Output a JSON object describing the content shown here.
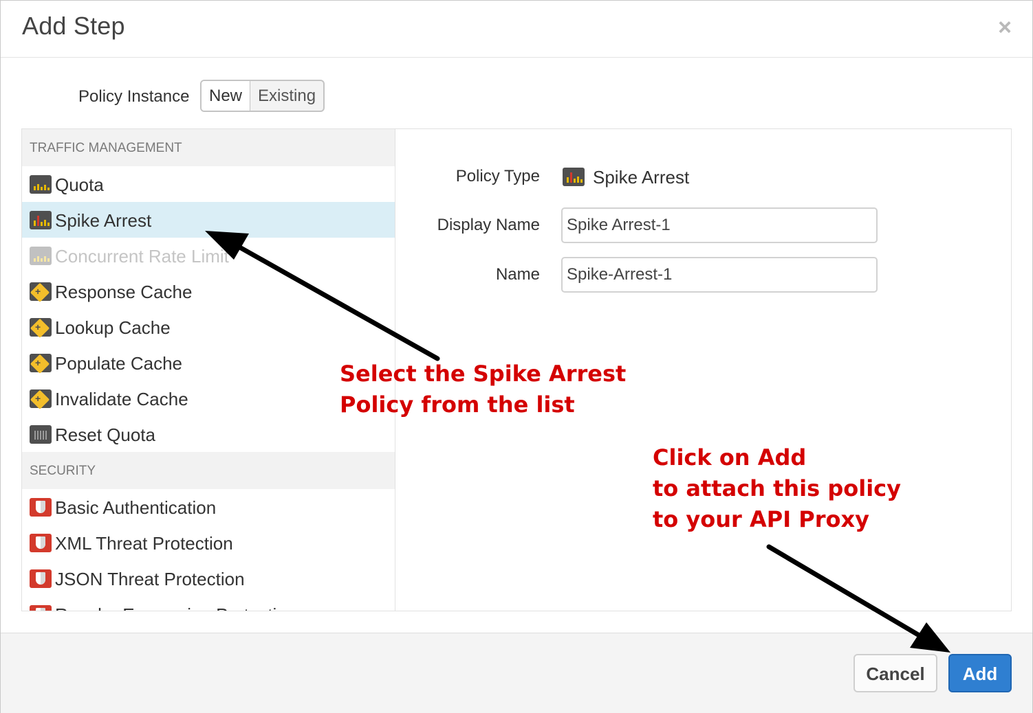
{
  "dialog": {
    "title": "Add Step",
    "close_glyph": "×"
  },
  "instance": {
    "label": "Policy Instance",
    "options": [
      "New",
      "Existing"
    ],
    "selected": "New"
  },
  "categories": [
    {
      "name": "TRAFFIC MANAGEMENT",
      "items": [
        {
          "label": "Quota",
          "icon": "quota-icon"
        },
        {
          "label": "Spike Arrest",
          "icon": "spike-arrest-icon",
          "selected": true
        },
        {
          "label": "Concurrent Rate Limit",
          "icon": "concurrent-rate-limit-icon",
          "disabled": true
        },
        {
          "label": "Response Cache",
          "icon": "cache-icon"
        },
        {
          "label": "Lookup Cache",
          "icon": "cache-icon"
        },
        {
          "label": "Populate Cache",
          "icon": "cache-icon"
        },
        {
          "label": "Invalidate Cache",
          "icon": "cache-icon"
        },
        {
          "label": "Reset Quota",
          "icon": "reset-quota-icon"
        }
      ]
    },
    {
      "name": "SECURITY",
      "items": [
        {
          "label": "Basic Authentication",
          "icon": "shield-icon"
        },
        {
          "label": "XML Threat Protection",
          "icon": "shield-icon"
        },
        {
          "label": "JSON Threat Protection",
          "icon": "shield-icon"
        },
        {
          "label": "Regular Expression Protection",
          "icon": "shield-icon"
        }
      ]
    }
  ],
  "detail": {
    "policy_type_label": "Policy Type",
    "policy_type_value": "Spike Arrest",
    "display_name_label": "Display Name",
    "display_name_value": "Spike Arrest-1",
    "name_label": "Name",
    "name_value": "Spike-Arrest-1"
  },
  "footer": {
    "cancel_label": "Cancel",
    "add_label": "Add"
  },
  "annotations": {
    "select_line1": "Select the Spike Arrest",
    "select_line2": "Policy from the list",
    "add_line1": "Click on Add",
    "add_line2": "to attach this policy",
    "add_line3": "to your API Proxy"
  },
  "colors": {
    "selected_row": "#daeef6",
    "primary_button": "#2f7fd1",
    "annotation_text": "#d40000",
    "icon_bg": "#4f4f4f",
    "icon_bars": "#e6b800",
    "security_icon": "#d33a2c"
  }
}
